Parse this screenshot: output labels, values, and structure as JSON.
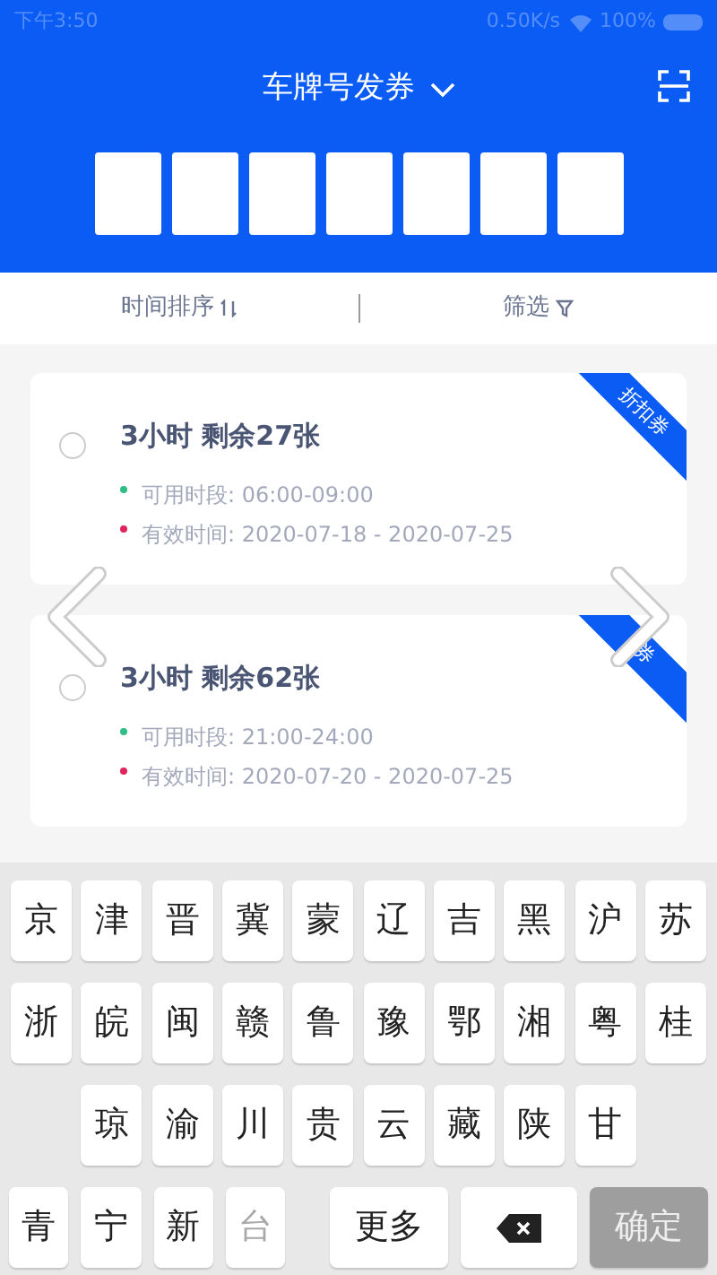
{
  "status_bar": {
    "time": "下午3:50",
    "speed": "0.50K/s",
    "battery": "100%"
  },
  "header": {
    "title": "车牌号发券"
  },
  "sort_bar": {
    "sort_label": "时间排序",
    "filter_label": "筛选"
  },
  "coupons": [
    {
      "title": "3小时 剩余27张",
      "selected": false,
      "ribbon": "折扣券",
      "lines": [
        {
          "text": "可用时段: 06:00-09:00",
          "color": "#2ebd85"
        },
        {
          "text": "有效时间: 2020-07-18 - 2020-07-25",
          "color": "#e0245e"
        }
      ]
    },
    {
      "title": "3小时 剩余62张",
      "selected": false,
      "ribbon": "券",
      "lines": [
        {
          "text": "可用时段: 21:00-24:00",
          "color": "#2ebd85"
        },
        {
          "text": "有效时间: 2020-07-20 - 2020-07-25",
          "color": "#e0245e"
        }
      ]
    }
  ],
  "keyboard": {
    "rows": [
      {
        "keys": [
          {
            "kind": "char",
            "label": "京"
          },
          {
            "kind": "char",
            "label": "津"
          },
          {
            "kind": "char",
            "label": "晋"
          },
          {
            "kind": "char",
            "label": "冀"
          },
          {
            "kind": "char",
            "label": "蒙"
          },
          {
            "kind": "char",
            "label": "辽"
          },
          {
            "kind": "char",
            "label": "吉"
          },
          {
            "kind": "char",
            "label": "黑"
          },
          {
            "kind": "char",
            "label": "沪"
          },
          {
            "kind": "char",
            "label": "苏"
          }
        ]
      },
      {
        "keys": [
          {
            "kind": "char",
            "label": "浙"
          },
          {
            "kind": "char",
            "label": "皖"
          },
          {
            "kind": "char",
            "label": "闽"
          },
          {
            "kind": "char",
            "label": "赣"
          },
          {
            "kind": "char",
            "label": "鲁"
          },
          {
            "kind": "char",
            "label": "豫"
          },
          {
            "kind": "char",
            "label": "鄂"
          },
          {
            "kind": "char",
            "label": "湘"
          },
          {
            "kind": "char",
            "label": "粤"
          },
          {
            "kind": "char",
            "label": "桂"
          }
        ]
      },
      {
        "keys": [
          {
            "kind": "char",
            "label": "琼"
          },
          {
            "kind": "char",
            "label": "渝"
          },
          {
            "kind": "char",
            "label": "川"
          },
          {
            "kind": "char",
            "label": "贵"
          },
          {
            "kind": "char",
            "label": "云"
          },
          {
            "kind": "char",
            "label": "藏"
          },
          {
            "kind": "char",
            "label": "陕"
          },
          {
            "kind": "char",
            "label": "甘"
          }
        ]
      },
      {
        "keys": [
          {
            "kind": "char",
            "label": "青",
            "disabled": false
          },
          {
            "kind": "char",
            "label": "宁",
            "disabled": false
          },
          {
            "kind": "char",
            "label": "新",
            "disabled": false
          },
          {
            "kind": "char",
            "label": "台",
            "disabled": true
          },
          {
            "kind": "more",
            "label": "更多"
          },
          {
            "kind": "backspace"
          },
          {
            "kind": "confirm",
            "label": "确定"
          }
        ]
      }
    ]
  }
}
